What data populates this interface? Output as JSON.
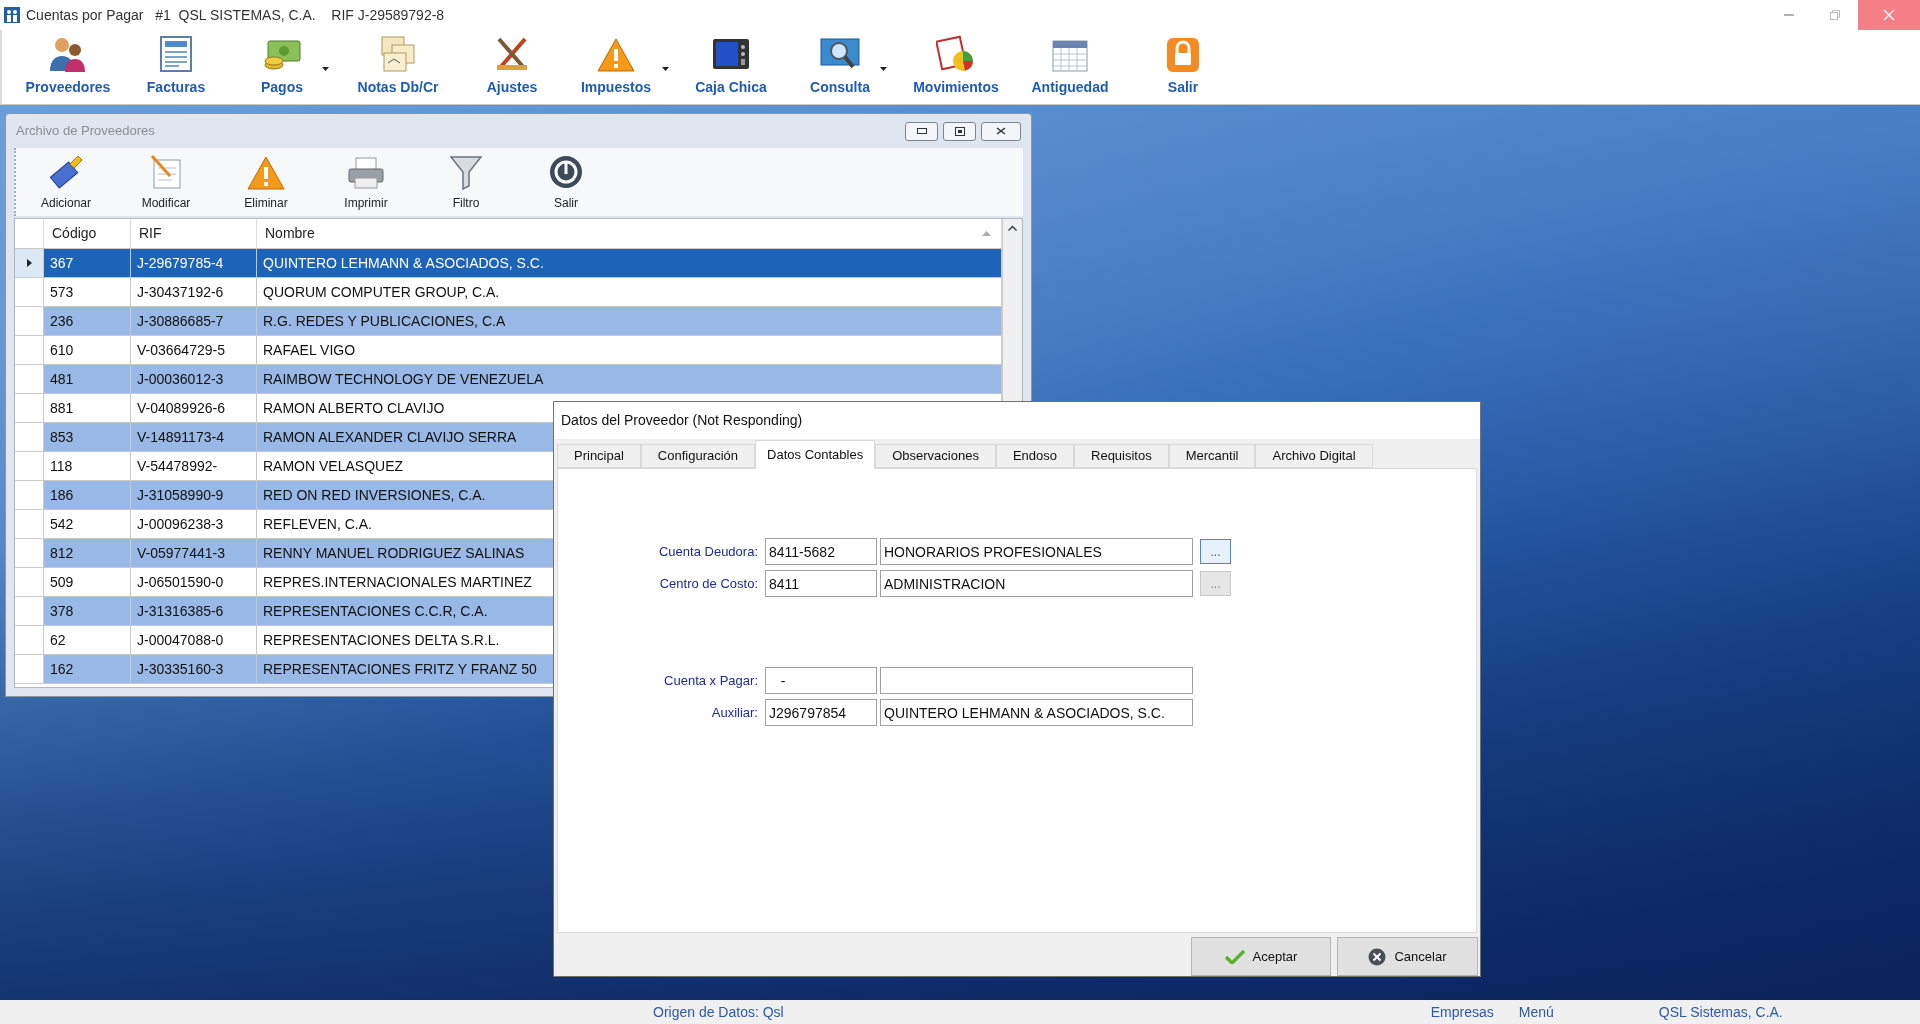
{
  "window": {
    "title": "Cuentas por Pagar   #1  QSL SISTEMAS, C.A.    RIF J-29589792-8"
  },
  "toolbar": [
    {
      "label": "Proveedores",
      "dropdown": false
    },
    {
      "label": "Facturas",
      "dropdown": false
    },
    {
      "label": "Pagos",
      "dropdown": true
    },
    {
      "label": "Notas Db/Cr",
      "dropdown": false
    },
    {
      "label": "Ajustes",
      "dropdown": false
    },
    {
      "label": "Impuestos",
      "dropdown": true
    },
    {
      "label": "Caja Chica",
      "dropdown": false
    },
    {
      "label": "Consulta",
      "dropdown": true
    },
    {
      "label": "Movimientos",
      "dropdown": false
    },
    {
      "label": "Antiguedad",
      "dropdown": false
    },
    {
      "label": "Salir",
      "dropdown": false
    }
  ],
  "archivo_window": {
    "title": "Archivo de Proveedores",
    "toolbar": [
      "Adicionar",
      "Modificar",
      "Eliminar",
      "Imprimir",
      "Filtro",
      "Salir"
    ],
    "table": {
      "columns": [
        "Código",
        "RIF",
        "Nombre"
      ],
      "rows": [
        {
          "cells": [
            "367",
            "J-29679785-4",
            "QUINTERO LEHMANN & ASOCIADOS, S.C."
          ],
          "selected": true
        },
        {
          "cells": [
            "573",
            "J-30437192-6",
            "QUORUM COMPUTER GROUP, C.A."
          ],
          "selected": false
        },
        {
          "cells": [
            "236",
            "J-30886685-7",
            "R.G. REDES Y PUBLICACIONES, C.A"
          ],
          "selected": false
        },
        {
          "cells": [
            "610",
            "V-03664729-5",
            "RAFAEL VIGO"
          ],
          "selected": false
        },
        {
          "cells": [
            "481",
            "J-00036012-3",
            "RAIMBOW TECHNOLOGY DE VENEZUELA"
          ],
          "selected": false
        },
        {
          "cells": [
            "881",
            "V-04089926-6",
            "RAMON ALBERTO CLAVIJO"
          ],
          "selected": false
        },
        {
          "cells": [
            "853",
            "V-14891173-4",
            "RAMON ALEXANDER CLAVIJO SERRA"
          ],
          "selected": false
        },
        {
          "cells": [
            "118",
            "V-54478992-",
            "RAMON VELASQUEZ"
          ],
          "selected": false
        },
        {
          "cells": [
            "186",
            "J-31058990-9",
            "RED ON RED INVERSIONES, C.A."
          ],
          "selected": false
        },
        {
          "cells": [
            "542",
            "J-00096238-3",
            "REFLEVEN, C.A."
          ],
          "selected": false
        },
        {
          "cells": [
            "812",
            "V-05977441-3",
            "RENNY MANUEL RODRIGUEZ SALINAS"
          ],
          "selected": false
        },
        {
          "cells": [
            "509",
            "J-06501590-0",
            "REPRES.INTERNACIONALES MARTINEZ"
          ],
          "selected": false
        },
        {
          "cells": [
            "378",
            "J-31316385-6",
            "REPRESENTACIONES C.C.R, C.A."
          ],
          "selected": false
        },
        {
          "cells": [
            "62",
            "J-00047088-0",
            "REPRESENTACIONES DELTA S.R.L."
          ],
          "selected": false
        },
        {
          "cells": [
            "162",
            "J-30335160-3",
            "REPRESENTACIONES FRITZ Y FRANZ 50"
          ],
          "selected": false
        }
      ]
    }
  },
  "dialog": {
    "title": "Datos del Proveedor (Not Responding)",
    "tabs": [
      {
        "label": "Principal",
        "selected": false
      },
      {
        "label": "Configuración",
        "selected": false
      },
      {
        "label": "Datos Contables",
        "selected": true
      },
      {
        "label": "Observaciones",
        "selected": false
      },
      {
        "label": "Endoso",
        "selected": false
      },
      {
        "label": "Requisitos",
        "selected": false
      },
      {
        "label": "Mercantil",
        "selected": false
      },
      {
        "label": "Archivo Digital",
        "selected": false
      }
    ],
    "groups": [
      [
        {
          "label": "Cuenta Deudora:",
          "code": "8411-5682",
          "description": "HONORARIOS PROFESIONALES",
          "button": {
            "label": "...",
            "disabled": false
          }
        },
        {
          "label": "Centro de Costo:",
          "code": "8411",
          "description": "ADMINISTRACION",
          "button": {
            "label": "...",
            "disabled": true
          }
        }
      ],
      [
        {
          "label": "Cuenta x Pagar:",
          "code": "   -"
        },
        {
          "label": "Auxiliar:",
          "code": "J296797854",
          "description": "QUINTERO LEHMANN & ASOCIADOS, S.C."
        }
      ]
    ],
    "buttons": [
      {
        "label": "Aceptar",
        "kind": "ok"
      },
      {
        "label": "Cancelar",
        "kind": "cancel"
      }
    ]
  },
  "status_bar": {
    "source": "Origen de Datos: Qsl",
    "links": [
      "Empresas",
      "Menú"
    ],
    "company": "QSL Sistemas, C.A."
  }
}
